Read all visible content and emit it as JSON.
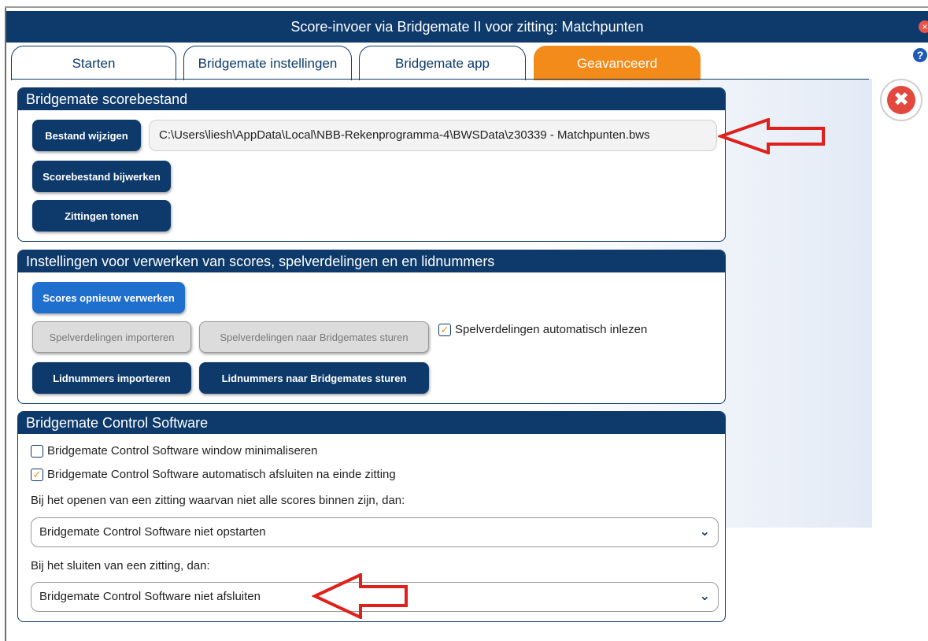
{
  "window": {
    "title": "Score-invoer via Bridgemate II voor zitting: Matchpunten",
    "close_glyph": "×",
    "help_glyph": "?",
    "close_big_glyph": "✖"
  },
  "tabs": [
    {
      "label": "Starten",
      "active": false
    },
    {
      "label": "Bridgemate instellingen",
      "active": false
    },
    {
      "label": "Bridgemate app",
      "active": false
    },
    {
      "label": "Geavanceerd",
      "active": true
    }
  ],
  "scorebestand": {
    "header": "Bridgemate scorebestand",
    "btn_wijzigen": "Bestand wijzigen",
    "path": "C:\\Users\\liesh\\AppData\\Local\\NBB-Rekenprogramma-4\\BWSData\\z30339 - Matchpunten.bws",
    "btn_bijwerken": "Scorebestand bijwerken",
    "btn_zittingen": "Zittingen tonen"
  },
  "instellingen": {
    "header": "Instellingen voor verwerken van scores, spelverdelingen en en lidnummers",
    "btn_scores": "Scores opnieuw verwerken",
    "btn_spel_import": "Spelverdelingen importeren",
    "btn_spel_sturen": "Spelverdelingen naar Bridgemates sturen",
    "chk_auto_label": "Spelverdelingen automatisch inlezen",
    "chk_auto_checked": true,
    "btn_lid_import": "Lidnummers importeren",
    "btn_lid_sturen": "Lidnummers naar Bridgemates sturen"
  },
  "control": {
    "header": "Bridgemate Control Software",
    "chk_min_label": "Bridgemate Control Software window minimaliseren",
    "chk_min_checked": false,
    "chk_close_label": "Bridgemate Control Software automatisch afsluiten na einde zitting",
    "chk_close_checked": true,
    "open_label": "Bij het openen van een zitting waarvan niet alle scores binnen zijn, dan:",
    "open_value": "Bridgemate Control Software niet opstarten",
    "sluit_label": "Bij het sluiten van een zitting, dan:",
    "sluit_value": "Bridgemate Control Software niet afsluiten"
  },
  "colors": {
    "navy": "#0d3a6b",
    "orange": "#f38b1a",
    "arrow_red": "#e0201a"
  }
}
